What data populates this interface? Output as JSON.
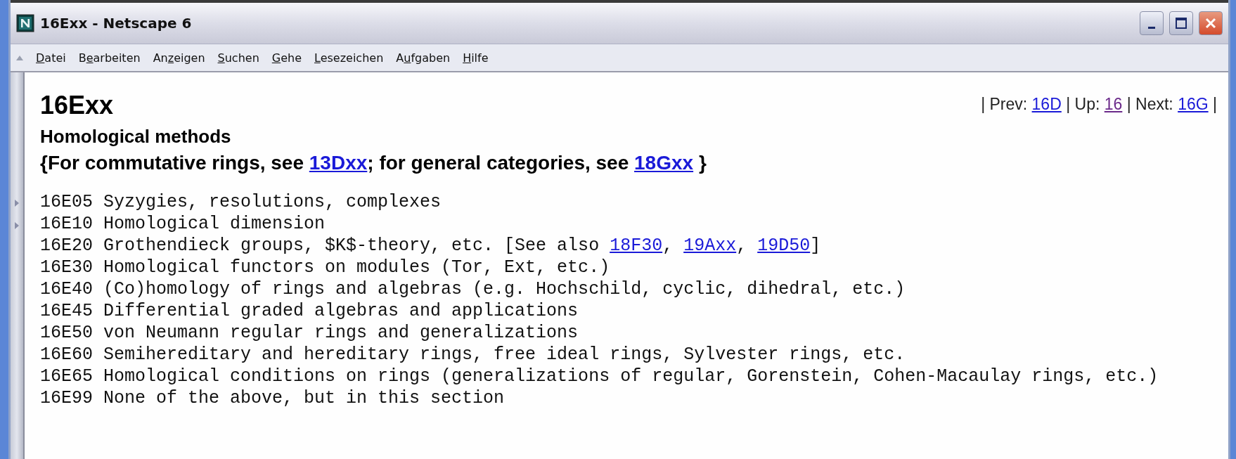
{
  "window": {
    "title": "16Exx - Netscape 6"
  },
  "menu": [
    {
      "key": "D",
      "after": "atei"
    },
    {
      "before": "B",
      "key": "e",
      "after": "arbeiten"
    },
    {
      "before": "An",
      "key": "z",
      "after": "eigen"
    },
    {
      "key": "S",
      "after": "uchen"
    },
    {
      "key": "G",
      "after": "ehe"
    },
    {
      "key": "L",
      "after": "esezeichen"
    },
    {
      "before": "A",
      "key": "u",
      "after": "fgaben"
    },
    {
      "key": "H",
      "after": "ilfe"
    }
  ],
  "page": {
    "heading": "16Exx",
    "subtitle": "Homological methods",
    "note": [
      {
        "kind": "text",
        "text": "{For commutative rings, see "
      },
      {
        "kind": "link",
        "text": "13Dxx"
      },
      {
        "kind": "text",
        "text": "; for general categories, see "
      },
      {
        "kind": "link",
        "text": "18Gxx"
      },
      {
        "kind": "text",
        "text": " }"
      }
    ],
    "nav": [
      {
        "kind": "text",
        "text": "| Prev: "
      },
      {
        "kind": "link",
        "text": "16D",
        "visited": false
      },
      {
        "kind": "text",
        "text": " | Up: "
      },
      {
        "kind": "link",
        "text": "16",
        "visited": true
      },
      {
        "kind": "text",
        "text": " | Next: "
      },
      {
        "kind": "link",
        "text": "16G",
        "visited": false
      },
      {
        "kind": "text",
        "text": " |"
      }
    ],
    "entries": [
      {
        "parts": [
          {
            "kind": "text",
            "text": "16E05 Syzygies, resolutions, complexes"
          }
        ]
      },
      {
        "parts": [
          {
            "kind": "text",
            "text": "16E10 Homological dimension"
          }
        ]
      },
      {
        "parts": [
          {
            "kind": "text",
            "text": "16E20 Grothendieck groups, $K$-theory, etc. [See also "
          },
          {
            "kind": "link",
            "text": "18F30"
          },
          {
            "kind": "text",
            "text": ", "
          },
          {
            "kind": "link",
            "text": "19Axx"
          },
          {
            "kind": "text",
            "text": ", "
          },
          {
            "kind": "link",
            "text": "19D50"
          },
          {
            "kind": "text",
            "text": "]"
          }
        ]
      },
      {
        "parts": [
          {
            "kind": "text",
            "text": "16E30 Homological functors on modules (Tor, Ext, etc.)"
          }
        ]
      },
      {
        "parts": [
          {
            "kind": "text",
            "text": "16E40 (Co)homology of rings and algebras (e.g. Hochschild, cyclic, dihedral, etc.)"
          }
        ]
      },
      {
        "parts": [
          {
            "kind": "text",
            "text": "16E45 Differential graded algebras and applications"
          }
        ]
      },
      {
        "parts": [
          {
            "kind": "text",
            "text": "16E50 von Neumann regular rings and generalizations"
          }
        ]
      },
      {
        "parts": [
          {
            "kind": "text",
            "text": "16E60 Semihereditary and hereditary rings, free ideal rings, Sylvester rings, etc."
          }
        ]
      },
      {
        "parts": [
          {
            "kind": "text",
            "text": "16E65 Homological conditions on rings (generalizations of regular, Gorenstein, Cohen-Macaulay rings, etc.)"
          }
        ]
      },
      {
        "parts": [
          {
            "kind": "text",
            "text": "16E99 None of the above, but in this section"
          }
        ]
      }
    ]
  }
}
